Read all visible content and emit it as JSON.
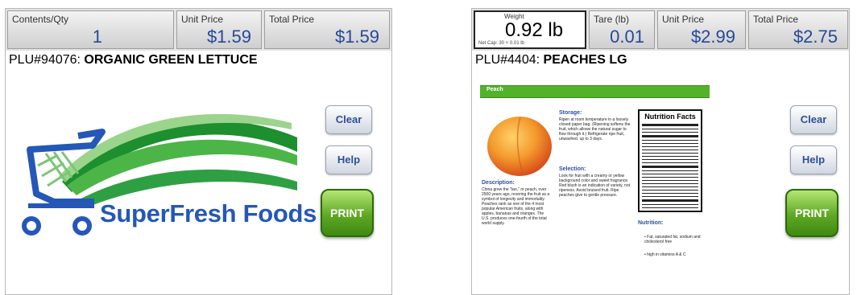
{
  "left": {
    "header": {
      "contents_label": "Contents/Qty",
      "contents_value": "1",
      "unit_price_label": "Unit Price",
      "unit_price_value": "$1.59",
      "total_price_label": "Total Price",
      "total_price_value": "$1.59"
    },
    "plu_code": "PLU#94076:",
    "product_name": "ORGANIC GREEN LETTUCE",
    "buttons": {
      "clear": "Clear",
      "help": "Help",
      "print": "PRINT"
    },
    "logo_text": "SuperFresh Foods"
  },
  "right": {
    "header": {
      "weight_label": "Weight",
      "weight_value": "0.92 lb",
      "weight_sub": "Net   Cap: 30 × 0.01 lb",
      "tare_label": "Tare (lb)",
      "tare_value": "0.01",
      "unit_price_label": "Unit Price",
      "unit_price_value": "$2.99",
      "total_price_label": "Total Price",
      "total_price_value": "$2.75"
    },
    "plu_code": "PLU#4404:",
    "product_name": "PEACHES LG",
    "info_card": {
      "title": "Peach",
      "storage_heading": "Storage:",
      "storage_text": "Ripen at room temperature in a loosely closed paper bag. (Ripening softens the fruit, which allows the natural sugar to flow through it.) Refrigerate ripe fruit, unwashed, up to 3 days.",
      "selection_heading": "Selection:",
      "selection_text": "Look for fruit with a creamy or yellow background color and sweet fragrance. Red blush is an indication of variety, not ripeness. Avoid bruised fruit. Ripe peaches give to gentle pressure.",
      "description_heading": "Description:",
      "description_text": "China grew the \"tao,\" or peach, over 2500 years ago, revering the fruit as a symbol of longevity and immortality. Peaches rank as one of the 4 most popular American fruits, along with apples, bananas and oranges. The U.S. produces one-fourth of the total world supply.",
      "nutrition_heading": "Nutrition:",
      "nutrition_items": [
        "Fat, saturated fat, sodium and cholesterol free",
        "high in vitamins A & C"
      ],
      "nutrition_facts_title": "Nutrition Facts"
    },
    "buttons": {
      "clear": "Clear",
      "help": "Help",
      "print": "PRINT"
    }
  },
  "colors": {
    "price_text": "#244a9a",
    "print_button": "#5fa824",
    "logo_blue": "#2457b8",
    "info_bar_green": "#52b22a"
  },
  "icons": {
    "logo": "shopping-cart-with-green-ribbons",
    "product_image": "peach"
  }
}
